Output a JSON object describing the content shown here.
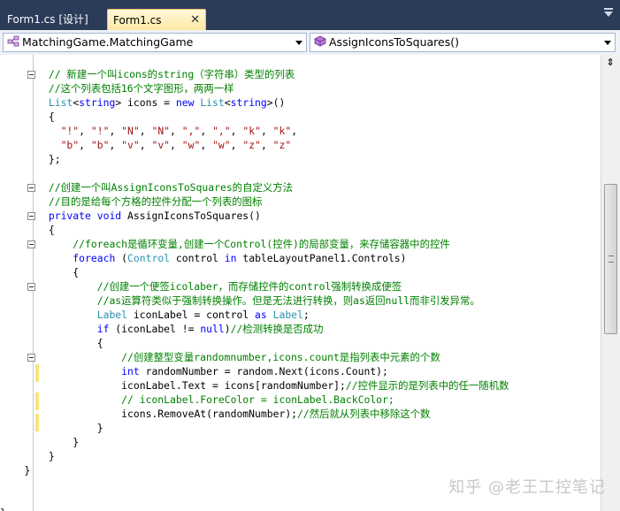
{
  "tabs": {
    "design_label": "Form1.cs [设计]",
    "code_label": "Form1.cs",
    "close_glyph": "✕"
  },
  "navbar": {
    "type_label": "MatchingGame.MatchingGame",
    "member_label": "AssignIconsToSquares()"
  },
  "scrollbar": {
    "split_glyph": "⇕"
  },
  "code_lines": [
    [
      [
        "c",
        "        // 新建一个叫icons的string（字符串）类型的列表"
      ]
    ],
    [
      [
        "c",
        "        //这个列表包括16个文字图形，两两一样"
      ]
    ],
    [
      [
        "t",
        "        List"
      ],
      [
        "p",
        "<"
      ],
      [
        "k",
        "string"
      ],
      [
        "p",
        "> icons = "
      ],
      [
        "k",
        "new"
      ],
      [
        "p",
        " "
      ],
      [
        "t",
        "List"
      ],
      [
        "p",
        "<"
      ],
      [
        "k",
        "string"
      ],
      [
        "p",
        ">()"
      ]
    ],
    [
      [
        "p",
        "        {"
      ]
    ],
    [
      [
        "p",
        "          "
      ],
      [
        "s",
        "\"!\""
      ],
      [
        "p",
        ", "
      ],
      [
        "s",
        "\"!\""
      ],
      [
        "p",
        ", "
      ],
      [
        "s",
        "\"N\""
      ],
      [
        "p",
        ", "
      ],
      [
        "s",
        "\"N\""
      ],
      [
        "p",
        ", "
      ],
      [
        "s",
        "\",\""
      ],
      [
        "p",
        ", "
      ],
      [
        "s",
        "\",\""
      ],
      [
        "p",
        ", "
      ],
      [
        "s",
        "\"k\""
      ],
      [
        "p",
        ", "
      ],
      [
        "s",
        "\"k\""
      ],
      [
        "p",
        ","
      ]
    ],
    [
      [
        "p",
        "          "
      ],
      [
        "s",
        "\"b\""
      ],
      [
        "p",
        ", "
      ],
      [
        "s",
        "\"b\""
      ],
      [
        "p",
        ", "
      ],
      [
        "s",
        "\"v\""
      ],
      [
        "p",
        ", "
      ],
      [
        "s",
        "\"v\""
      ],
      [
        "p",
        ", "
      ],
      [
        "s",
        "\"w\""
      ],
      [
        "p",
        ", "
      ],
      [
        "s",
        "\"w\""
      ],
      [
        "p",
        ", "
      ],
      [
        "s",
        "\"z\""
      ],
      [
        "p",
        ", "
      ],
      [
        "s",
        "\"z\""
      ]
    ],
    [
      [
        "p",
        "        };"
      ]
    ],
    [
      [
        "p",
        ""
      ]
    ],
    [
      [
        "c",
        "        //创建一个叫AssignIconsToSquares的自定义方法"
      ]
    ],
    [
      [
        "c",
        "        //目的是给每个方格的控件分配一个列表的图标"
      ]
    ],
    [
      [
        "k",
        "        private void"
      ],
      [
        "p",
        " AssignIconsToSquares()"
      ]
    ],
    [
      [
        "p",
        "        {"
      ]
    ],
    [
      [
        "c",
        "            //foreach是循环变量,创建一个Control(控件)的局部变量，来存储容器中的控件"
      ]
    ],
    [
      [
        "k",
        "            foreach"
      ],
      [
        "p",
        " ("
      ],
      [
        "t",
        "Control"
      ],
      [
        "p",
        " control "
      ],
      [
        "k",
        "in"
      ],
      [
        "p",
        " tableLayoutPanel1.Controls)"
      ]
    ],
    [
      [
        "p",
        "            {"
      ]
    ],
    [
      [
        "c",
        "                //创建一个便签icolaber，而存储控件的control强制转换成便签"
      ]
    ],
    [
      [
        "c",
        "                //as运算符类似于强制转换操作。但是无法进行转换，则as返回null而非引发异常。"
      ]
    ],
    [
      [
        "t",
        "                Label"
      ],
      [
        "p",
        " iconLabel = control "
      ],
      [
        "k",
        "as"
      ],
      [
        "p",
        " "
      ],
      [
        "t",
        "Label"
      ],
      [
        "p",
        ";"
      ]
    ],
    [
      [
        "k",
        "                if"
      ],
      [
        "p",
        " (iconLabel != "
      ],
      [
        "k",
        "null"
      ],
      [
        "p",
        ")"
      ],
      [
        "c",
        "//检测转换是否成功"
      ]
    ],
    [
      [
        "p",
        "                {"
      ]
    ],
    [
      [
        "c",
        "                    //创建整型变量randomnumber,icons.count是指列表中元素的个数"
      ]
    ],
    [
      [
        "k",
        "                    int"
      ],
      [
        "p",
        " randomNumber = random.Next(icons.Count);"
      ]
    ],
    [
      [
        "p",
        "                    iconLabel.Text = icons[randomNumber];"
      ],
      [
        "c",
        "//控件显示的是列表中的任一随机数"
      ]
    ],
    [
      [
        "c",
        "                    // iconLabel.ForeColor = iconLabel.BackColor;"
      ]
    ],
    [
      [
        "p",
        "                    icons.RemoveAt(randomNumber);"
      ],
      [
        "c",
        "//然后就从列表中移除这个数"
      ]
    ],
    [
      [
        "p",
        "                }"
      ]
    ],
    [
      [
        "p",
        "            }"
      ]
    ],
    [
      [
        "p",
        "        }"
      ]
    ],
    [
      [
        "p",
        "    }"
      ]
    ],
    [
      [
        "p",
        ""
      ]
    ],
    [
      [
        "p",
        ""
      ]
    ],
    [
      [
        "p",
        "}"
      ]
    ]
  ],
  "watermark": "知乎 @老王工控笔记"
}
